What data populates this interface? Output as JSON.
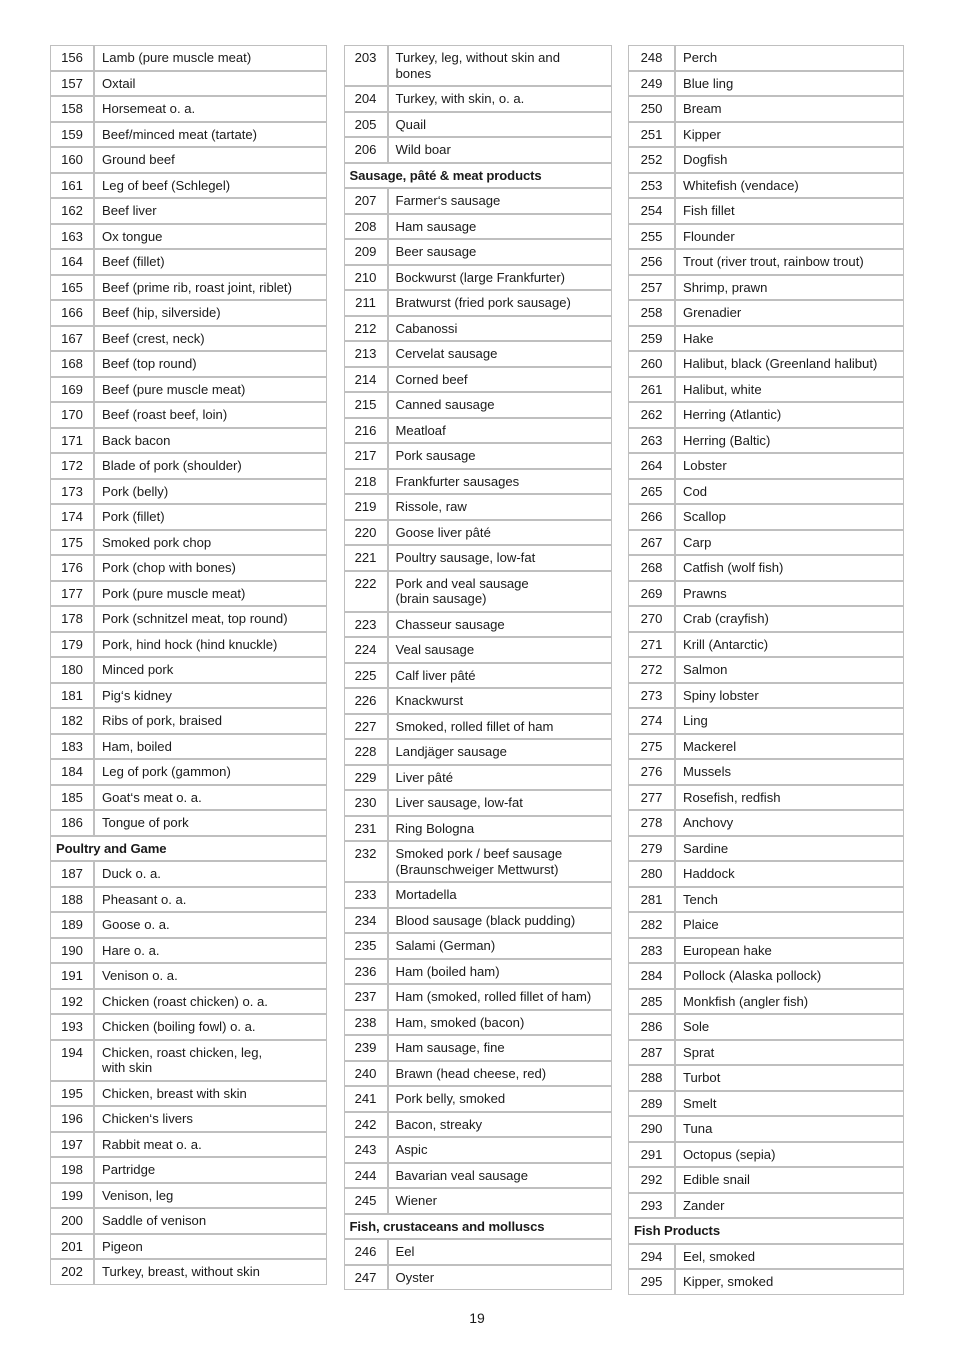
{
  "document": {
    "page_number": "19",
    "border_color": "#bfbfbf",
    "text_color": "#1a1a1a",
    "background": "#ffffff"
  },
  "columns": [
    {
      "id": "column-1",
      "rows": [
        {
          "type": "item",
          "num": "156",
          "lines": [
            "Lamb (pure muscle meat)"
          ]
        },
        {
          "type": "item",
          "num": "157",
          "lines": [
            "Oxtail"
          ]
        },
        {
          "type": "item",
          "num": "158",
          "lines": [
            "Horsemeat o. a."
          ]
        },
        {
          "type": "item",
          "num": "159",
          "lines": [
            "Beef/minced meat (tartate)"
          ]
        },
        {
          "type": "item",
          "num": "160",
          "lines": [
            "Ground beef"
          ]
        },
        {
          "type": "item",
          "num": "161",
          "lines": [
            "Leg of beef (Schlegel)"
          ]
        },
        {
          "type": "item",
          "num": "162",
          "lines": [
            "Beef liver"
          ]
        },
        {
          "type": "item",
          "num": "163",
          "lines": [
            "Ox tongue"
          ]
        },
        {
          "type": "item",
          "num": "164",
          "lines": [
            "Beef (fillet)"
          ]
        },
        {
          "type": "item",
          "num": "165",
          "lines": [
            "Beef (prime rib, roast joint, riblet)"
          ]
        },
        {
          "type": "item",
          "num": "166",
          "lines": [
            "Beef (hip, silverside)"
          ]
        },
        {
          "type": "item",
          "num": "167",
          "lines": [
            "Beef (crest, neck)"
          ]
        },
        {
          "type": "item",
          "num": "168",
          "lines": [
            "Beef (top round)"
          ]
        },
        {
          "type": "item",
          "num": "169",
          "lines": [
            "Beef (pure muscle meat)"
          ]
        },
        {
          "type": "item",
          "num": "170",
          "lines": [
            "Beef (roast beef, loin)"
          ]
        },
        {
          "type": "item",
          "num": "171",
          "lines": [
            "Back bacon"
          ]
        },
        {
          "type": "item",
          "num": "172",
          "lines": [
            "Blade of pork (shoulder)"
          ]
        },
        {
          "type": "item",
          "num": "173",
          "lines": [
            "Pork (belly)"
          ]
        },
        {
          "type": "item",
          "num": "174",
          "lines": [
            "Pork (fillet)"
          ]
        },
        {
          "type": "item",
          "num": "175",
          "lines": [
            "Smoked pork chop"
          ]
        },
        {
          "type": "item",
          "num": "176",
          "lines": [
            "Pork (chop with bones)"
          ]
        },
        {
          "type": "item",
          "num": "177",
          "lines": [
            "Pork (pure muscle meat)"
          ]
        },
        {
          "type": "item",
          "num": "178",
          "lines": [
            "Pork (schnitzel meat, top round)"
          ]
        },
        {
          "type": "item",
          "num": "179",
          "lines": [
            "Pork, hind hock (hind knuckle)"
          ]
        },
        {
          "type": "item",
          "num": "180",
          "lines": [
            "Minced pork"
          ]
        },
        {
          "type": "item",
          "num": "181",
          "lines": [
            "Pig‘s kidney"
          ]
        },
        {
          "type": "item",
          "num": "182",
          "lines": [
            "Ribs of pork, braised"
          ]
        },
        {
          "type": "item",
          "num": "183",
          "lines": [
            "Ham, boiled"
          ]
        },
        {
          "type": "item",
          "num": "184",
          "lines": [
            "Leg of pork (gammon)"
          ]
        },
        {
          "type": "item",
          "num": "185",
          "lines": [
            "Goat‘s meat o. a."
          ]
        },
        {
          "type": "item",
          "num": "186",
          "lines": [
            "Tongue of pork"
          ]
        },
        {
          "type": "section",
          "label": "Poultry and Game"
        },
        {
          "type": "item",
          "num": "187",
          "lines": [
            "Duck o. a."
          ]
        },
        {
          "type": "item",
          "num": "188",
          "lines": [
            "Pheasant o. a."
          ]
        },
        {
          "type": "item",
          "num": "189",
          "lines": [
            "Goose o. a."
          ]
        },
        {
          "type": "item",
          "num": "190",
          "lines": [
            "Hare o. a."
          ]
        },
        {
          "type": "item",
          "num": "191",
          "lines": [
            "Venison o. a."
          ]
        },
        {
          "type": "item",
          "num": "192",
          "lines": [
            "Chicken (roast chicken) o. a."
          ]
        },
        {
          "type": "item",
          "num": "193",
          "lines": [
            "Chicken (boiling fowl) o. a."
          ]
        },
        {
          "type": "item",
          "num": "194",
          "lines": [
            "Chicken, roast chicken, leg,",
            "with skin"
          ]
        },
        {
          "type": "item",
          "num": "195",
          "lines": [
            "Chicken, breast with skin"
          ]
        },
        {
          "type": "item",
          "num": "196",
          "lines": [
            "Chicken‘s livers"
          ]
        },
        {
          "type": "item",
          "num": "197",
          "lines": [
            "Rabbit meat o. a."
          ]
        },
        {
          "type": "item",
          "num": "198",
          "lines": [
            "Partridge"
          ]
        },
        {
          "type": "item",
          "num": "199",
          "lines": [
            "Venison, leg"
          ]
        },
        {
          "type": "item",
          "num": "200",
          "lines": [
            "Saddle of venison"
          ]
        },
        {
          "type": "item",
          "num": "201",
          "lines": [
            "Pigeon"
          ]
        },
        {
          "type": "item",
          "num": "202",
          "lines": [
            "Turkey, breast, without skin"
          ]
        }
      ]
    },
    {
      "id": "column-2",
      "rows": [
        {
          "type": "item",
          "num": "203",
          "lines": [
            "Turkey, leg, without skin and",
            "bones"
          ]
        },
        {
          "type": "item",
          "num": "204",
          "lines": [
            "Turkey, with skin, o. a."
          ]
        },
        {
          "type": "item",
          "num": "205",
          "lines": [
            "Quail"
          ]
        },
        {
          "type": "item",
          "num": "206",
          "lines": [
            "Wild boar"
          ]
        },
        {
          "type": "section",
          "label": "Sausage, pâté & meat products"
        },
        {
          "type": "item",
          "num": "207",
          "lines": [
            "Farmer‘s sausage"
          ]
        },
        {
          "type": "item",
          "num": "208",
          "lines": [
            "Ham sausage"
          ]
        },
        {
          "type": "item",
          "num": "209",
          "lines": [
            "Beer sausage"
          ]
        },
        {
          "type": "item",
          "num": "210",
          "lines": [
            "Bockwurst (large Frankfurter)"
          ]
        },
        {
          "type": "item",
          "num": "211",
          "lines": [
            "Bratwurst (fried pork sausage)"
          ]
        },
        {
          "type": "item",
          "num": "212",
          "lines": [
            "Cabanossi"
          ]
        },
        {
          "type": "item",
          "num": "213",
          "lines": [
            "Cervelat sausage"
          ]
        },
        {
          "type": "item",
          "num": "214",
          "lines": [
            "Corned beef"
          ]
        },
        {
          "type": "item",
          "num": "215",
          "lines": [
            "Canned sausage"
          ]
        },
        {
          "type": "item",
          "num": "216",
          "lines": [
            "Meatloaf"
          ]
        },
        {
          "type": "item",
          "num": "217",
          "lines": [
            "Pork sausage"
          ]
        },
        {
          "type": "item",
          "num": "218",
          "lines": [
            "Frankfurter sausages"
          ]
        },
        {
          "type": "item",
          "num": "219",
          "lines": [
            "Rissole, raw"
          ]
        },
        {
          "type": "item",
          "num": "220",
          "lines": [
            "Goose liver pâté"
          ]
        },
        {
          "type": "item",
          "num": "221",
          "lines": [
            "Poultry sausage, low-fat"
          ]
        },
        {
          "type": "item",
          "num": "222",
          "lines": [
            "Pork and veal sausage",
            "(brain sausage)"
          ]
        },
        {
          "type": "item",
          "num": "223",
          "lines": [
            "Chasseur sausage"
          ]
        },
        {
          "type": "item",
          "num": "224",
          "lines": [
            "Veal sausage"
          ]
        },
        {
          "type": "item",
          "num": "225",
          "lines": [
            "Calf liver pâté"
          ]
        },
        {
          "type": "item",
          "num": "226",
          "lines": [
            "Knackwurst"
          ]
        },
        {
          "type": "item",
          "num": "227",
          "lines": [
            "Smoked, rolled fillet of ham"
          ]
        },
        {
          "type": "item",
          "num": "228",
          "lines": [
            "Landjäger sausage"
          ]
        },
        {
          "type": "item",
          "num": "229",
          "lines": [
            "Liver pâté"
          ]
        },
        {
          "type": "item",
          "num": "230",
          "lines": [
            "Liver sausage, low-fat"
          ]
        },
        {
          "type": "item",
          "num": "231",
          "lines": [
            "Ring Bologna"
          ]
        },
        {
          "type": "item",
          "num": "232",
          "lines": [
            "Smoked pork / beef sausage",
            "(Braunschweiger Mettwurst)"
          ]
        },
        {
          "type": "item",
          "num": "233",
          "lines": [
            "Mortadella"
          ]
        },
        {
          "type": "item",
          "num": "234",
          "lines": [
            "Blood sausage (black pudding)"
          ]
        },
        {
          "type": "item",
          "num": "235",
          "lines": [
            "Salami (German)"
          ]
        },
        {
          "type": "item",
          "num": "236",
          "lines": [
            "Ham (boiled ham)"
          ]
        },
        {
          "type": "item",
          "num": "237",
          "lines": [
            "Ham (smoked, rolled fillet of ham)"
          ]
        },
        {
          "type": "item",
          "num": "238",
          "lines": [
            "Ham, smoked (bacon)"
          ]
        },
        {
          "type": "item",
          "num": "239",
          "lines": [
            "Ham sausage, fine"
          ]
        },
        {
          "type": "item",
          "num": "240",
          "lines": [
            "Brawn (head cheese, red)"
          ]
        },
        {
          "type": "item",
          "num": "241",
          "lines": [
            "Pork belly, smoked"
          ]
        },
        {
          "type": "item",
          "num": "242",
          "lines": [
            "Bacon, streaky"
          ]
        },
        {
          "type": "item",
          "num": "243",
          "lines": [
            "Aspic"
          ]
        },
        {
          "type": "item",
          "num": "244",
          "lines": [
            "Bavarian veal sausage"
          ]
        },
        {
          "type": "item",
          "num": "245",
          "lines": [
            "Wiener"
          ]
        },
        {
          "type": "section",
          "label": "Fish, crustaceans and molluscs"
        },
        {
          "type": "item",
          "num": "246",
          "lines": [
            "Eel"
          ]
        },
        {
          "type": "item",
          "num": "247",
          "lines": [
            "Oyster"
          ]
        }
      ]
    },
    {
      "id": "column-3",
      "rows": [
        {
          "type": "item",
          "num": "248",
          "lines": [
            "Perch"
          ]
        },
        {
          "type": "item",
          "num": "249",
          "lines": [
            "Blue ling"
          ]
        },
        {
          "type": "item",
          "num": "250",
          "lines": [
            "Bream"
          ]
        },
        {
          "type": "item",
          "num": "251",
          "lines": [
            "Kipper"
          ]
        },
        {
          "type": "item",
          "num": "252",
          "lines": [
            "Dogfish"
          ]
        },
        {
          "type": "item",
          "num": "253",
          "lines": [
            "Whitefish (vendace)"
          ]
        },
        {
          "type": "item",
          "num": "254",
          "lines": [
            "Fish fillet"
          ]
        },
        {
          "type": "item",
          "num": "255",
          "lines": [
            "Flounder"
          ]
        },
        {
          "type": "item",
          "num": "256",
          "lines": [
            "Trout (river trout, rainbow trout)"
          ]
        },
        {
          "type": "item",
          "num": "257",
          "lines": [
            "Shrimp, prawn"
          ]
        },
        {
          "type": "item",
          "num": "258",
          "lines": [
            "Grenadier"
          ]
        },
        {
          "type": "item",
          "num": "259",
          "lines": [
            "Hake"
          ]
        },
        {
          "type": "item",
          "num": "260",
          "lines": [
            "Halibut, black (Greenland halibut)"
          ]
        },
        {
          "type": "item",
          "num": "261",
          "lines": [
            "Halibut, white"
          ]
        },
        {
          "type": "item",
          "num": "262",
          "lines": [
            "Herring (Atlantic)"
          ]
        },
        {
          "type": "item",
          "num": "263",
          "lines": [
            "Herring (Baltic)"
          ]
        },
        {
          "type": "item",
          "num": "264",
          "lines": [
            "Lobster"
          ]
        },
        {
          "type": "item",
          "num": "265",
          "lines": [
            "Cod"
          ]
        },
        {
          "type": "item",
          "num": "266",
          "lines": [
            "Scallop"
          ]
        },
        {
          "type": "item",
          "num": "267",
          "lines": [
            "Carp"
          ]
        },
        {
          "type": "item",
          "num": "268",
          "lines": [
            "Catfish (wolf fish)"
          ]
        },
        {
          "type": "item",
          "num": "269",
          "lines": [
            "Prawns"
          ]
        },
        {
          "type": "item",
          "num": "270",
          "lines": [
            "Crab (crayfish)"
          ]
        },
        {
          "type": "item",
          "num": "271",
          "lines": [
            "Krill (Antarctic)"
          ]
        },
        {
          "type": "item",
          "num": "272",
          "lines": [
            "Salmon"
          ]
        },
        {
          "type": "item",
          "num": "273",
          "lines": [
            "Spiny lobster"
          ]
        },
        {
          "type": "item",
          "num": "274",
          "lines": [
            "Ling"
          ]
        },
        {
          "type": "item",
          "num": "275",
          "lines": [
            "Mackerel"
          ]
        },
        {
          "type": "item",
          "num": "276",
          "lines": [
            "Mussels"
          ]
        },
        {
          "type": "item",
          "num": "277",
          "lines": [
            "Rosefish, redfish"
          ]
        },
        {
          "type": "item",
          "num": "278",
          "lines": [
            "Anchovy"
          ]
        },
        {
          "type": "item",
          "num": "279",
          "lines": [
            "Sardine"
          ]
        },
        {
          "type": "item",
          "num": "280",
          "lines": [
            "Haddock"
          ]
        },
        {
          "type": "item",
          "num": "281",
          "lines": [
            "Tench"
          ]
        },
        {
          "type": "item",
          "num": "282",
          "lines": [
            "Plaice"
          ]
        },
        {
          "type": "item",
          "num": "283",
          "lines": [
            "European hake"
          ]
        },
        {
          "type": "item",
          "num": "284",
          "lines": [
            "Pollock (Alaska pollock)"
          ]
        },
        {
          "type": "item",
          "num": "285",
          "lines": [
            "Monkfish (angler fish)"
          ]
        },
        {
          "type": "item",
          "num": "286",
          "lines": [
            "Sole"
          ]
        },
        {
          "type": "item",
          "num": "287",
          "lines": [
            "Sprat"
          ]
        },
        {
          "type": "item",
          "num": "288",
          "lines": [
            "Turbot"
          ]
        },
        {
          "type": "item",
          "num": "289",
          "lines": [
            "Smelt"
          ]
        },
        {
          "type": "item",
          "num": "290",
          "lines": [
            "Tuna"
          ]
        },
        {
          "type": "item",
          "num": "291",
          "lines": [
            "Octopus (sepia)"
          ]
        },
        {
          "type": "item",
          "num": "292",
          "lines": [
            "Edible snail"
          ]
        },
        {
          "type": "item",
          "num": "293",
          "lines": [
            "Zander"
          ]
        },
        {
          "type": "section",
          "label": "Fish Products"
        },
        {
          "type": "item",
          "num": "294",
          "lines": [
            "Eel, smoked"
          ]
        },
        {
          "type": "item",
          "num": "295",
          "lines": [
            "Kipper, smoked"
          ]
        }
      ]
    }
  ]
}
